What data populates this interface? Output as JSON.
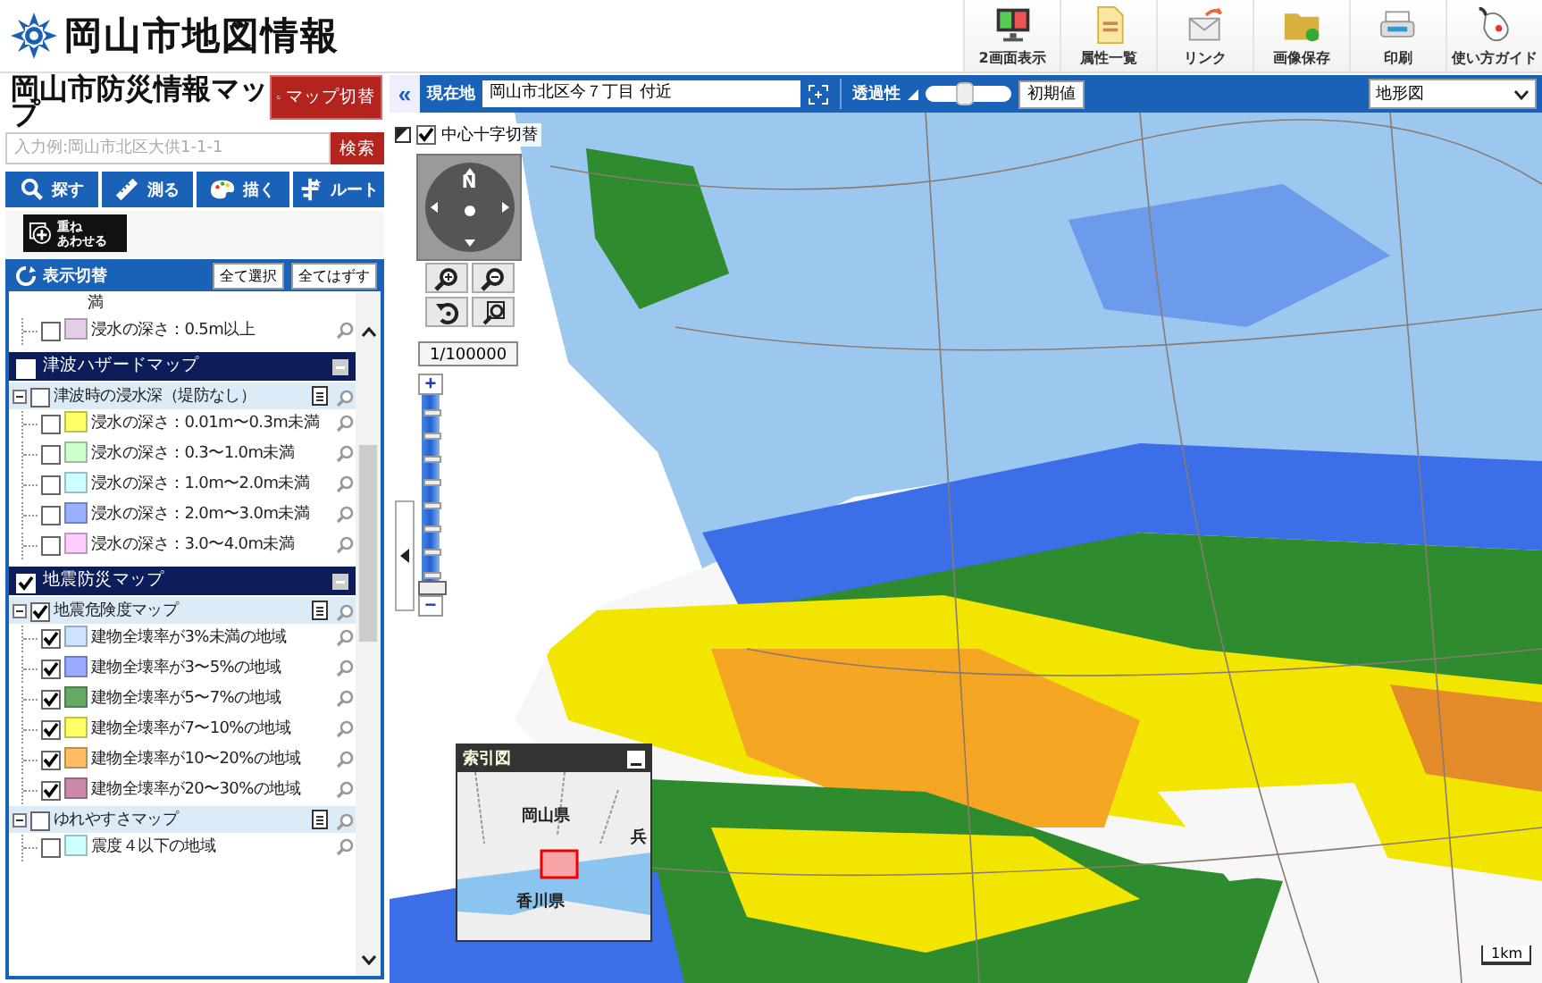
{
  "header": {
    "title": "岡山市地図情報",
    "tools": [
      {
        "kind": "dual",
        "label": "2画面表示"
      },
      {
        "kind": "list",
        "label": "属性一覧"
      },
      {
        "kind": "link",
        "label": "リンク"
      },
      {
        "kind": "save",
        "label": "画像保存"
      },
      {
        "kind": "print",
        "label": "印刷"
      },
      {
        "kind": "guide",
        "label": "使い方ガイド"
      }
    ]
  },
  "side_panel": {
    "title": "岡山市防災情報マップ",
    "switch_button": "マップ切替",
    "search": {
      "placeholder": "入力例:岡山市北区大供1-1-1",
      "button": "検索"
    },
    "tools": [
      {
        "kind": "search",
        "label": "探す"
      },
      {
        "kind": "measure",
        "label": "測る"
      },
      {
        "kind": "draw",
        "label": "描く"
      },
      {
        "kind": "route",
        "label": "ルート"
      }
    ],
    "overlay_button": {
      "lines": [
        "重ね",
        "あわせる"
      ]
    },
    "display_switch": {
      "title": "表示切替",
      "buttons": [
        "全て選択",
        "全てはずす"
      ]
    },
    "layers": [
      {
        "kind": "tail",
        "label": "満"
      },
      {
        "kind": "item",
        "label": "浸水の深さ：0.5m以上",
        "checked": false,
        "color": "#e6cce6"
      },
      {
        "kind": "section",
        "label": "津波ハザードマップ",
        "checked": false,
        "children": [
          {
            "kind": "group",
            "label": "津波時の浸水深（堤防なし）",
            "checked": false,
            "expanded": true,
            "children": [
              {
                "kind": "item",
                "label": "浸水の深さ：0.01m〜0.3m未満",
                "checked": false,
                "color": "#ffff66"
              },
              {
                "kind": "item",
                "label": "浸水の深さ：0.3〜1.0m未満",
                "checked": false,
                "color": "#ccffcc"
              },
              {
                "kind": "item",
                "label": "浸水の深さ：1.0m〜2.0m未満",
                "checked": false,
                "color": "#ccffff"
              },
              {
                "kind": "item",
                "label": "浸水の深さ：2.0m〜3.0m未満",
                "checked": false,
                "color": "#99b0ff"
              },
              {
                "kind": "item",
                "label": "浸水の深さ：3.0〜4.0m未満",
                "checked": false,
                "color": "#ffccff"
              }
            ]
          }
        ]
      },
      {
        "kind": "section",
        "label": "地震防災マップ",
        "checked": true,
        "children": [
          {
            "kind": "group",
            "label": "地震危険度マップ",
            "checked": true,
            "expanded": true,
            "children": [
              {
                "kind": "item",
                "label": "建物全壊率が3%未満の地域",
                "checked": true,
                "color": "#cce4ff"
              },
              {
                "kind": "item",
                "label": "建物全壊率が3〜5%の地域",
                "checked": true,
                "color": "#99aaff"
              },
              {
                "kind": "item",
                "label": "建物全壊率が5〜7%の地域",
                "checked": true,
                "color": "#66aa66"
              },
              {
                "kind": "item",
                "label": "建物全壊率が7〜10%の地域",
                "checked": true,
                "color": "#ffff66"
              },
              {
                "kind": "item",
                "label": "建物全壊率が10〜20%の地域",
                "checked": true,
                "color": "#ffbb66"
              },
              {
                "kind": "item",
                "label": "建物全壊率が20〜30%の地域",
                "checked": true,
                "color": "#cc88aa"
              }
            ]
          },
          {
            "kind": "group",
            "label": "ゆれやすさマップ",
            "checked": false,
            "expanded": true,
            "children": [
              {
                "kind": "item",
                "label": "震度４以下の地域",
                "checked": false,
                "color": "#ccffff"
              }
            ]
          }
        ]
      }
    ]
  },
  "map": {
    "toolbar": {
      "collapse": "«",
      "location_label": "現在地",
      "location": "岡山市北区今７丁目 付近",
      "opacity_label": "透過性",
      "opacity": {
        "level": 0.45
      },
      "reset_button": "初期値",
      "basemap": "地形図"
    },
    "crosshair": {
      "label": "中心十字切替",
      "checked": true
    },
    "compass": "N",
    "scale": "1/100000",
    "zoom": {
      "zoom_in": "+",
      "zoom_out": "−",
      "level": 0
    },
    "index_map": {
      "title": "索引図",
      "labels": [
        "岡山県",
        "香川県",
        "兵"
      ]
    },
    "scale_bar": "1km"
  }
}
